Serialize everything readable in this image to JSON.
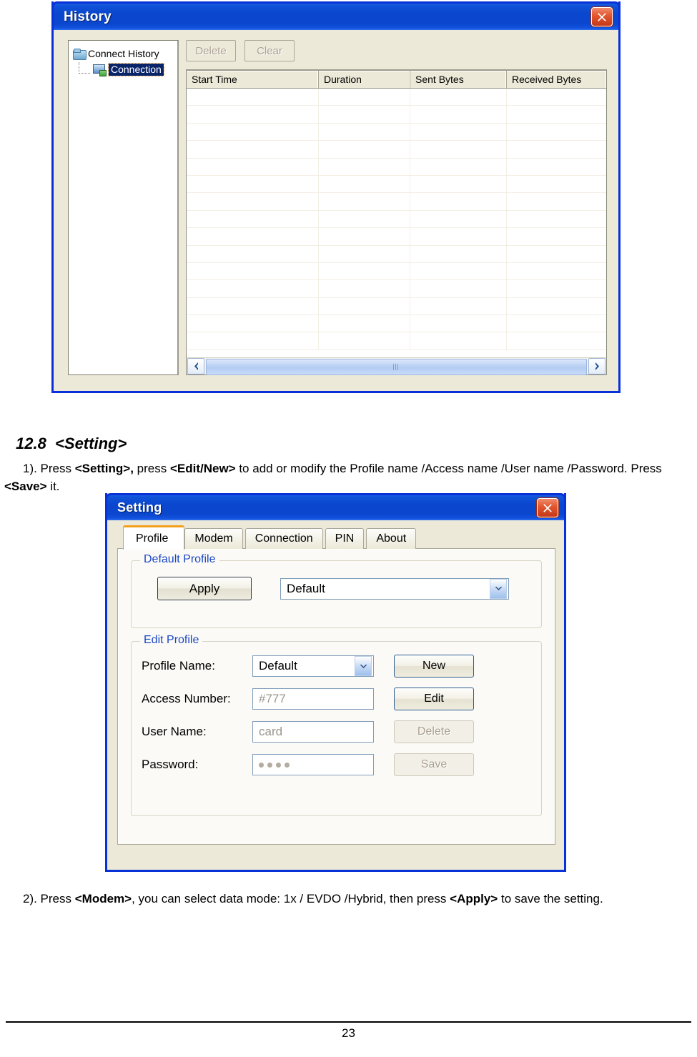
{
  "history_window": {
    "title": "History",
    "close_label": "×",
    "tree": {
      "root_label": "Connect History",
      "child_label": "Connection"
    },
    "buttons": {
      "delete_label": "Delete",
      "clear_label": "Clear"
    },
    "table": {
      "columns": [
        "Start Time",
        "Duration",
        "Sent Bytes",
        "Received Bytes"
      ],
      "rows": [
        [],
        [],
        [],
        [],
        [],
        [],
        [],
        [],
        [],
        [],
        [],
        [],
        [],
        [],
        []
      ]
    },
    "scrollbar": {
      "left_arrow": "‹",
      "right_arrow": "›"
    }
  },
  "document": {
    "section_heading": "12.8  <Setting>",
    "paragraph_1": {
      "prefix": "1). Press ",
      "b1": "<Setting>,",
      "mid1": " press ",
      "b2": "<Edit/New>",
      "mid2": " to add or modify the Profile name /Access name /User name /Password. Press ",
      "b3": "<Save>",
      "suffix": " it."
    },
    "paragraph_2": {
      "prefix": "2). Press ",
      "b1": "<Modem>",
      "mid1": ", you can select data mode: 1x / EVDO /Hybrid, then press ",
      "b2": "<Apply>",
      "suffix": " to save the setting."
    },
    "page_number": "23"
  },
  "setting_window": {
    "title": "Setting",
    "close_label": "×",
    "tabs": [
      {
        "label": "Profile",
        "active": true
      },
      {
        "label": "Modem",
        "active": false
      },
      {
        "label": "Connection",
        "active": false
      },
      {
        "label": "PIN",
        "active": false
      },
      {
        "label": "About",
        "active": false
      }
    ],
    "default_profile": {
      "group_title": "Default Profile",
      "apply_label": "Apply",
      "combo_value": "Default"
    },
    "edit_profile": {
      "group_title": "Edit Profile",
      "fields": [
        {
          "label": "Profile Name:",
          "value": "Default",
          "type": "combo",
          "button": "New",
          "button_enabled": true
        },
        {
          "label": "Access Number:",
          "value": "#777",
          "type": "text",
          "button": "Edit",
          "button_enabled": true
        },
        {
          "label": "User Name:",
          "value": "card",
          "type": "text",
          "button": "Delete",
          "button_enabled": false
        },
        {
          "label": "Password:",
          "value": "••••",
          "type": "password",
          "button": "Save",
          "button_enabled": false
        }
      ]
    }
  },
  "colors": {
    "titlebar_blue": "#0a46ce",
    "window_border": "#0831d9",
    "dialog_face": "#ece9d8",
    "group_label_blue": "#1b48c4",
    "active_tab_accent": "#f2a01a",
    "selection_blue": "#0a246a",
    "close_red": "#e2552d"
  }
}
